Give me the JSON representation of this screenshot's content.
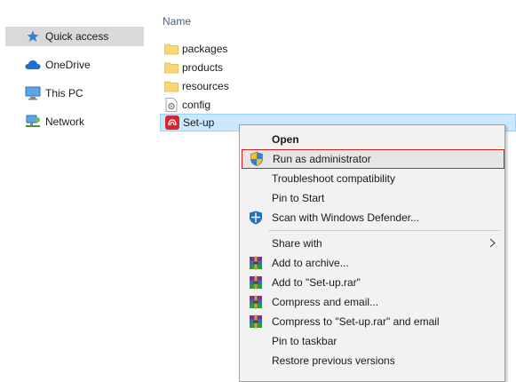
{
  "nav": {
    "items": [
      {
        "label": "Quick access",
        "icon": "star-icon",
        "selected": true
      },
      {
        "label": "OneDrive",
        "icon": "cloud-icon"
      },
      {
        "label": "This PC",
        "icon": "monitor-icon"
      },
      {
        "label": "Network",
        "icon": "network-icon"
      }
    ]
  },
  "file_list": {
    "column_name": "Name",
    "files": [
      {
        "name": "packages",
        "icon": "folder-icon"
      },
      {
        "name": "products",
        "icon": "folder-icon"
      },
      {
        "name": "resources",
        "icon": "folder-icon"
      },
      {
        "name": "config",
        "icon": "config-file-icon"
      },
      {
        "name": "Set-up",
        "icon": "setup-app-icon",
        "selected": true
      }
    ]
  },
  "context_menu": {
    "items": [
      {
        "label": "Open",
        "bold": true
      },
      {
        "label": "Run as administrator",
        "icon": "uac-shield-icon",
        "highlighted": true
      },
      {
        "label": "Troubleshoot compatibility"
      },
      {
        "label": "Pin to Start"
      },
      {
        "label": "Scan with Windows Defender...",
        "icon": "defender-icon"
      },
      {
        "label": "Share with",
        "has_submenu": true
      },
      {
        "label": "Add to archive...",
        "icon": "winrar-icon"
      },
      {
        "label": "Add to \"Set-up.rar\"",
        "icon": "winrar-icon"
      },
      {
        "label": "Compress and email...",
        "icon": "winrar-icon"
      },
      {
        "label": "Compress to \"Set-up.rar\" and email",
        "icon": "winrar-icon"
      },
      {
        "label": "Pin to taskbar"
      },
      {
        "label": "Restore previous versions"
      }
    ]
  },
  "colors": {
    "selection_fill": "#cce8ff",
    "highlight_border": "#d71e1e",
    "nav_selected": "#d9d9d9"
  }
}
